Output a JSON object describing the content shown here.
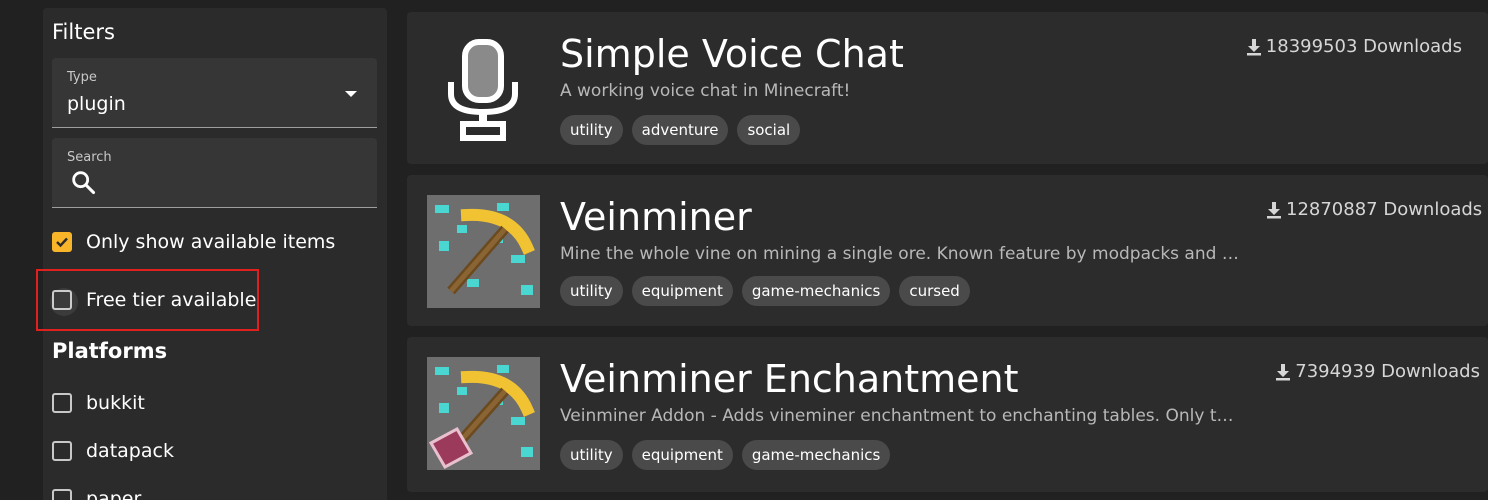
{
  "sidebar": {
    "title": "Filters",
    "type_field": {
      "label": "Type",
      "value": "plugin"
    },
    "search_field": {
      "label": "Search",
      "value": ""
    },
    "available": {
      "label": "Only show available items",
      "checked": true
    },
    "free_tier": {
      "label": "Free tier available",
      "checked": false
    },
    "platforms_title": "Platforms",
    "platforms": [
      {
        "label": "bukkit",
        "checked": false
      },
      {
        "label": "datapack",
        "checked": false
      },
      {
        "label": "paper",
        "checked": false
      }
    ]
  },
  "items": [
    {
      "title": "Simple Voice Chat",
      "description": "A working voice chat in Minecraft!",
      "downloads": "18399503 Downloads",
      "tags": [
        "utility",
        "adventure",
        "social"
      ],
      "icon": "microphone-icon"
    },
    {
      "title": "Veinminer",
      "description": "Mine the whole vine on mining a single ore. Known feature by modpacks and pvp games like UHC",
      "downloads": "12870887 Downloads",
      "tags": [
        "utility",
        "equipment",
        "game-mechanics",
        "cursed"
      ],
      "icon": "pickaxe-icon"
    },
    {
      "title": "Veinminer Enchantment",
      "description": "Veinminer Addon - Adds vineminer enchantment to enchanting tables. Only tools with the enchantment",
      "downloads": "7394939 Downloads",
      "tags": [
        "utility",
        "equipment",
        "game-mechanics"
      ],
      "icon": "enchanted-pickaxe-icon"
    }
  ],
  "colors": {
    "background": "#212121",
    "panel": "#2c2c2c",
    "accent_checkbox": "#f9b52a",
    "highlight_box": "#e0201e"
  }
}
